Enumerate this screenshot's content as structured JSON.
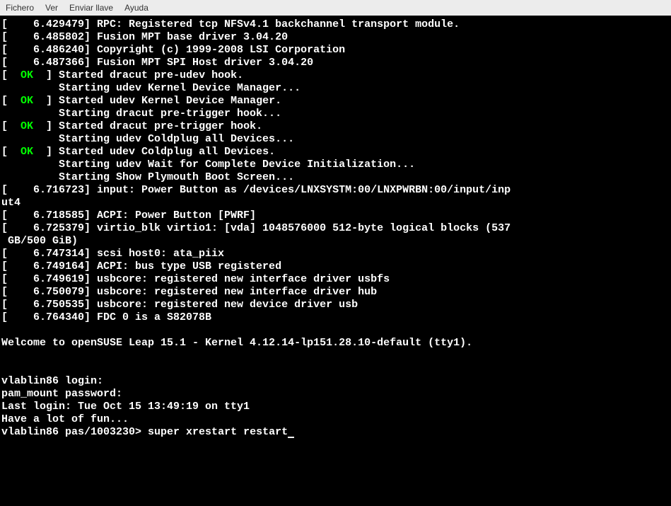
{
  "menubar": {
    "items": [
      "Fichero",
      "Ver",
      "Enviar llave",
      "Ayuda"
    ]
  },
  "terminal": {
    "lines": [
      {
        "type": "plain",
        "text": "[    6.429479] RPC: Registered tcp NFSv4.1 backchannel transport module."
      },
      {
        "type": "plain",
        "text": "[    6.485802] Fusion MPT base driver 3.04.20"
      },
      {
        "type": "plain",
        "text": "[    6.486240] Copyright (c) 1999-2008 LSI Corporation"
      },
      {
        "type": "plain",
        "text": "[    6.487366] Fusion MPT SPI Host driver 3.04.20"
      },
      {
        "type": "ok",
        "pre": "[  ",
        "ok": "OK",
        "post": "  ] Started dracut pre-udev hook."
      },
      {
        "type": "plain",
        "text": "         Starting udev Kernel Device Manager..."
      },
      {
        "type": "ok",
        "pre": "[  ",
        "ok": "OK",
        "post": "  ] Started udev Kernel Device Manager."
      },
      {
        "type": "plain",
        "text": "         Starting dracut pre-trigger hook..."
      },
      {
        "type": "ok",
        "pre": "[  ",
        "ok": "OK",
        "post": "  ] Started dracut pre-trigger hook."
      },
      {
        "type": "plain",
        "text": "         Starting udev Coldplug all Devices..."
      },
      {
        "type": "ok",
        "pre": "[  ",
        "ok": "OK",
        "post": "  ] Started udev Coldplug all Devices."
      },
      {
        "type": "plain",
        "text": "         Starting udev Wait for Complete Device Initialization..."
      },
      {
        "type": "plain",
        "text": "         Starting Show Plymouth Boot Screen..."
      },
      {
        "type": "plain",
        "text": "[    6.716723] input: Power Button as /devices/LNXSYSTM:00/LNXPWRBN:00/input/inp"
      },
      {
        "type": "plain",
        "text": "ut4"
      },
      {
        "type": "plain",
        "text": "[    6.718585] ACPI: Power Button [PWRF]"
      },
      {
        "type": "plain",
        "text": "[    6.725379] virtio_blk virtio1: [vda] 1048576000 512-byte logical blocks (537"
      },
      {
        "type": "plain",
        "text": " GB/500 GiB)"
      },
      {
        "type": "plain",
        "text": "[    6.747314] scsi host0: ata_piix"
      },
      {
        "type": "plain",
        "text": "[    6.749164] ACPI: bus type USB registered"
      },
      {
        "type": "plain",
        "text": "[    6.749619] usbcore: registered new interface driver usbfs"
      },
      {
        "type": "plain",
        "text": "[    6.750079] usbcore: registered new interface driver hub"
      },
      {
        "type": "plain",
        "text": "[    6.750535] usbcore: registered new device driver usb"
      },
      {
        "type": "plain",
        "text": "[    6.764340] FDC 0 is a S82078B"
      },
      {
        "type": "plain",
        "text": ""
      },
      {
        "type": "plain",
        "text": "Welcome to openSUSE Leap 15.1 - Kernel 4.12.14-lp151.28.10-default (tty1)."
      },
      {
        "type": "plain",
        "text": ""
      },
      {
        "type": "plain",
        "text": ""
      },
      {
        "type": "plain",
        "text": "vlablin86 login:"
      },
      {
        "type": "plain",
        "text": "pam_mount password:"
      },
      {
        "type": "plain",
        "text": "Last login: Tue Oct 15 13:49:19 on tty1"
      },
      {
        "type": "plain",
        "text": "Have a lot of fun..."
      },
      {
        "type": "prompt",
        "host": "vlablin86",
        "path": " pas/1003230> ",
        "cmd": "super xrestart restart"
      }
    ]
  }
}
